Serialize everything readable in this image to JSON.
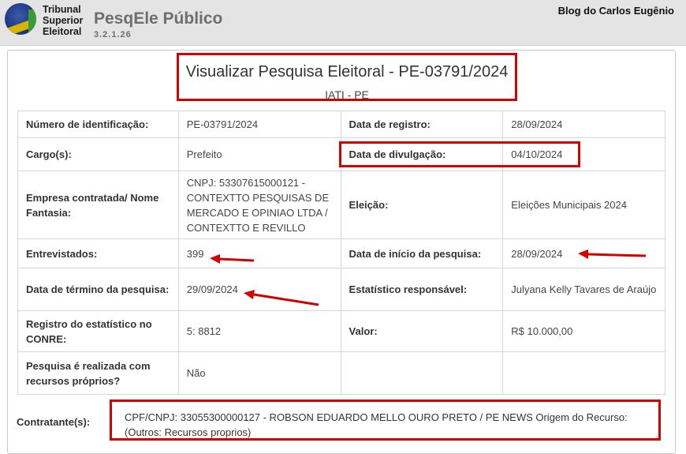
{
  "header": {
    "logo_lines": [
      "Tribunal",
      "Superior",
      "Eleitoral"
    ],
    "app_title": "PesqEle Público",
    "version": "3.2.1.26",
    "blog_credit": "Blog do Carlos Eugênio"
  },
  "page": {
    "title": "Visualizar Pesquisa Eleitoral - PE-03791/2024",
    "subtitle": "IATI - PE"
  },
  "details": [
    {
      "label": "Número de identificação:",
      "value": "PE-03791/2024",
      "label2": "Data de registro:",
      "value2": "28/09/2024"
    },
    {
      "label": "Cargo(s):",
      "value": "Prefeito",
      "label2": "Data de divulgação:",
      "value2": "04/10/2024"
    },
    {
      "label": "Empresa contratada/ Nome Fantasia:",
      "value": "CNPJ: 53307615000121 - CONTEXTTO PESQUISAS DE MERCADO E OPINIAO LTDA / CONTEXTTO E REVILLO",
      "label2": "Eleição:",
      "value2": "Eleições Municipais 2024"
    },
    {
      "label": "Entrevistados:",
      "value": "399",
      "label2": "Data de início da pesquisa:",
      "value2": "28/09/2024"
    },
    {
      "label": "Data de término da pesquisa:",
      "value": "29/09/2024",
      "label2": "Estatístico responsável:",
      "value2": "Julyana Kelly Tavares de Araújo"
    },
    {
      "label": "Registro do estatístico no CONRE:",
      "value": "5: 8812",
      "label2": "Valor:",
      "value2": "R$ 10.000,00"
    },
    {
      "label": "Pesquisa é realizada com recursos próprios?",
      "value": "Não"
    }
  ],
  "contratante": {
    "label": "Contratante(s):",
    "value": "CPF/CNPJ: 33055300000127 - ROBSON EDUARDO MELLO OURO PRETO / PE NEWS Origem do Recurso: (Outros: Recursos proprios)"
  }
}
